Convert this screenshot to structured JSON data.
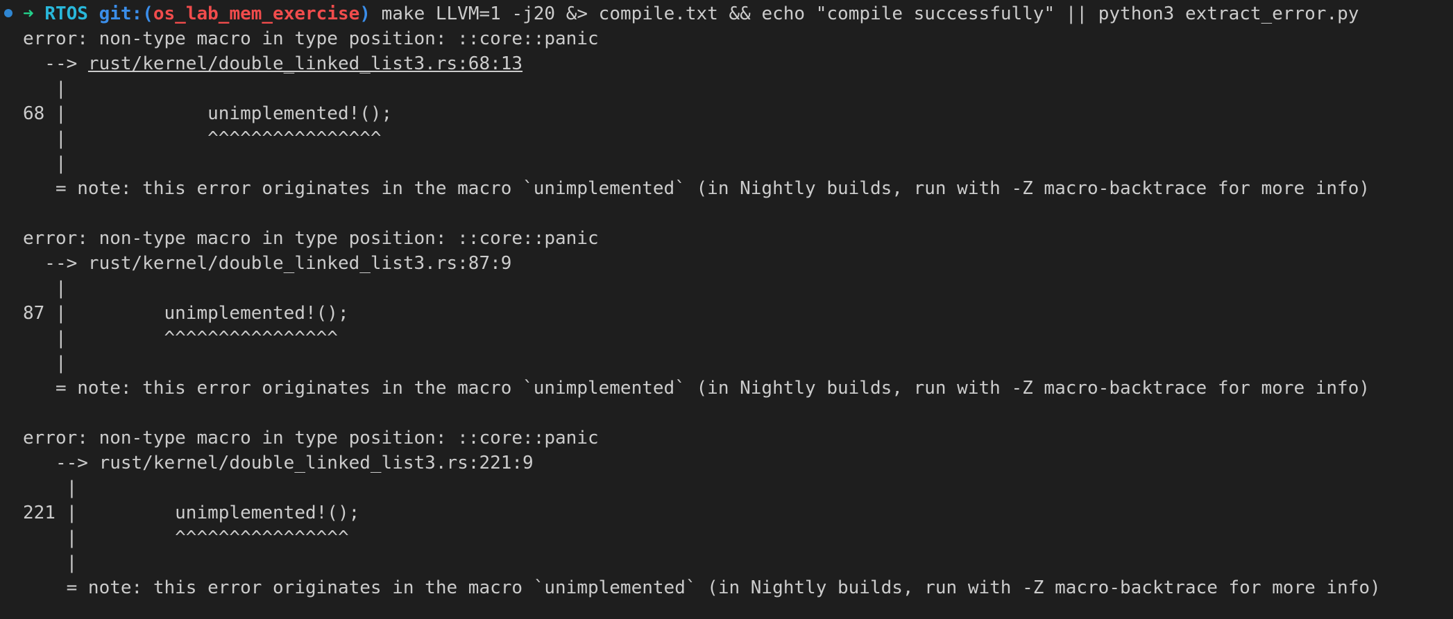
{
  "prompt": {
    "arrow": "➜",
    "directory": "RTOS",
    "git_prefix": "git:(",
    "branch": "os_lab_mem_exercise",
    "git_suffix": ")",
    "command": "make LLVM=1 -j20 &> compile.txt && echo \"compile successfully\" || python3 extract_error.py"
  },
  "output": {
    "e1_header": "error: non-type macro in type position: ::core::panic",
    "e1_arrow": "  --> ",
    "e1_location": "rust/kernel/double_linked_list3.rs:68:13",
    "e1_pipe1": "   |",
    "e1_code": "68 |             unimplemented!();",
    "e1_marker": "   |             ^^^^^^^^^^^^^^^^",
    "e1_pipe2": "   |",
    "e1_note": "   = note: this error originates in the macro `unimplemented` (in Nightly builds, run with -Z macro-backtrace for more info)",
    "e2_header": "error: non-type macro in type position: ::core::panic",
    "e2_location_line": "  --> rust/kernel/double_linked_list3.rs:87:9",
    "e2_pipe1": "   |",
    "e2_code": "87 |         unimplemented!();",
    "e2_marker": "   |         ^^^^^^^^^^^^^^^^",
    "e2_pipe2": "   |",
    "e2_note": "   = note: this error originates in the macro `unimplemented` (in Nightly builds, run with -Z macro-backtrace for more info)",
    "e3_header": "error: non-type macro in type position: ::core::panic",
    "e3_location_line": "   --> rust/kernel/double_linked_list3.rs:221:9",
    "e3_pipe1": "    |",
    "e3_code": "221 |         unimplemented!();",
    "e3_marker": "    |         ^^^^^^^^^^^^^^^^",
    "e3_pipe2": "    |",
    "e3_note": "    = note: this error originates in the macro `unimplemented` (in Nightly builds, run with -Z macro-backtrace for more info)"
  }
}
